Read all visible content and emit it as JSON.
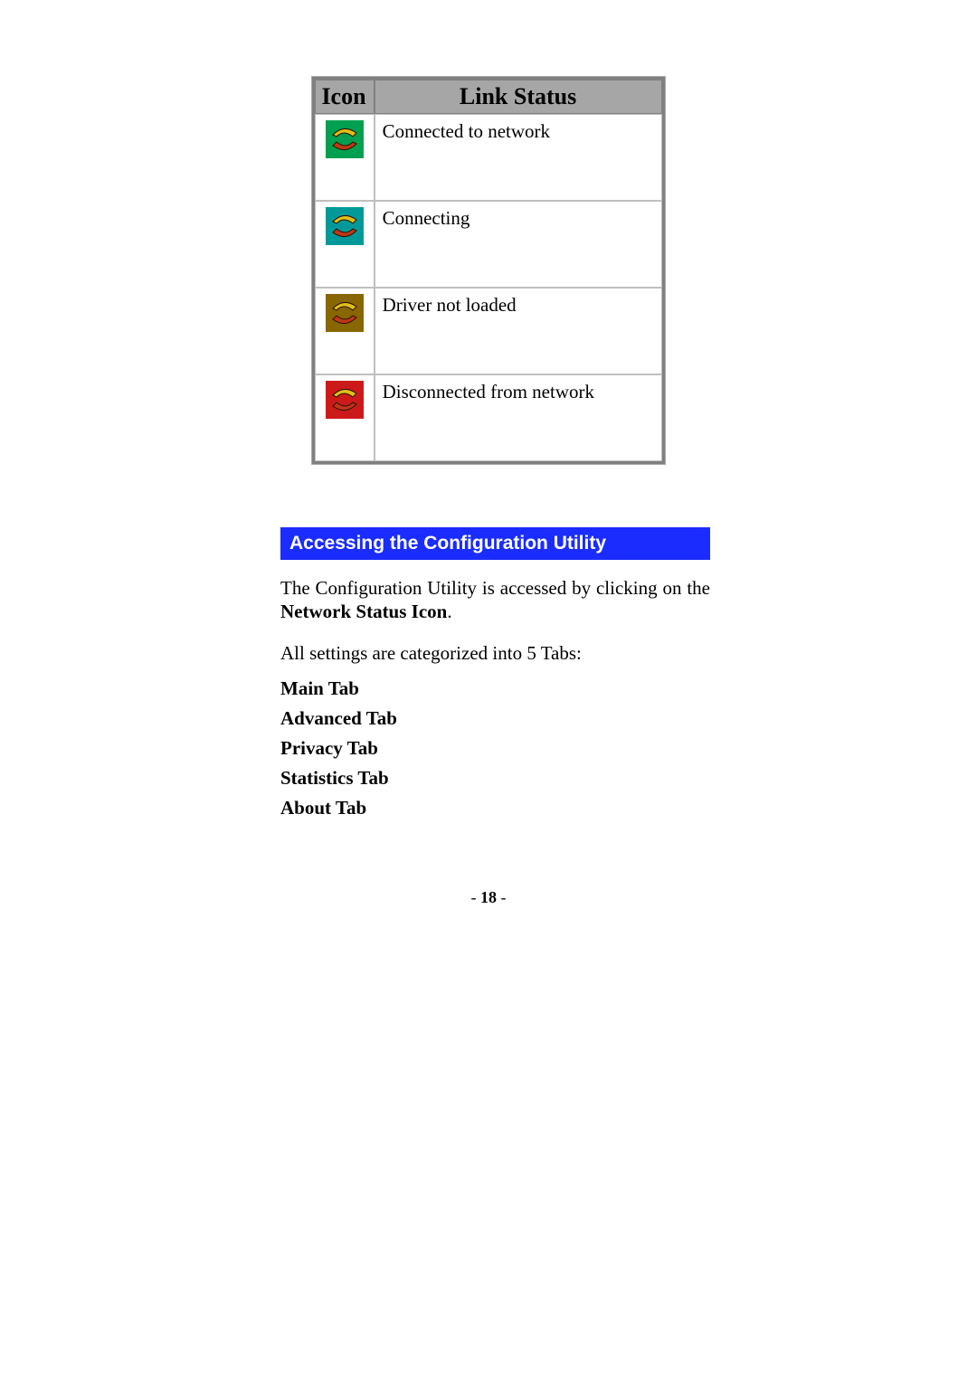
{
  "table": {
    "headers": {
      "icon": "Icon",
      "status": "Link Status"
    },
    "rows": [
      {
        "icon_bg": "green",
        "desc": "Connected to network"
      },
      {
        "icon_bg": "teal",
        "desc": "Connecting"
      },
      {
        "icon_bg": "olive",
        "desc": "Driver not loaded"
      },
      {
        "icon_bg": "red",
        "desc": "Disconnected from network"
      }
    ]
  },
  "section": {
    "title": "Accessing the Configuration Utility"
  },
  "body": {
    "para_prefix": "The Configuration Utility is accessed by clicking on the ",
    "para_bold1": "Network Status Icon",
    "para_suffix": ".",
    "tabs_intro": "All settings are categorized into 5 Tabs:",
    "tabs": [
      "Main Tab",
      "Advanced Tab",
      "Privacy Tab",
      "Statistics Tab",
      "About Tab"
    ]
  },
  "footer": {
    "page_left_dash": "- ",
    "page_number": "18",
    "page_right_dash": " -"
  }
}
